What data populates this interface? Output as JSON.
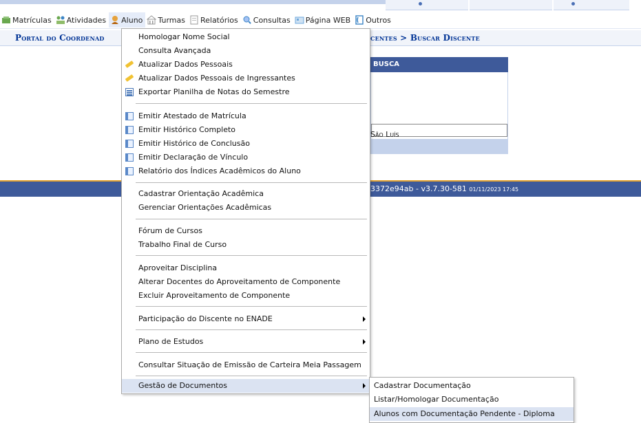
{
  "menubar": {
    "items": [
      {
        "label": "Matrículas",
        "icon": "enrollment-icon"
      },
      {
        "label": "Atividades",
        "icon": "activities-icon"
      },
      {
        "label": "Aluno",
        "icon": "student-icon"
      },
      {
        "label": "Turmas",
        "icon": "classes-icon"
      },
      {
        "label": "Relatórios",
        "icon": "reports-icon"
      },
      {
        "label": "Consultas",
        "icon": "search-icon"
      },
      {
        "label": "Página WEB",
        "icon": "web-page-icon"
      },
      {
        "label": "Outros",
        "icon": "phone-icon"
      }
    ]
  },
  "breadcrumb": {
    "left": "Portal do Coordenad",
    "right": "centes > Buscar Discente"
  },
  "search_panel": {
    "caption": "BUSCA",
    "campus_text": "São Luís"
  },
  "footer": {
    "version": "3372e94ab - v3.7.30-581",
    "datetime": "01/11/2023 17:45"
  },
  "aluno_menu": {
    "items": [
      {
        "label": "Homologar Nome Social",
        "icon": ""
      },
      {
        "label": "Consulta Avançada",
        "icon": ""
      },
      {
        "label": "Atualizar Dados Pessoais",
        "icon": "pencil-icon"
      },
      {
        "label": "Atualizar Dados Pessoais de Ingressantes",
        "icon": "pencil-icon"
      },
      {
        "label": "Exportar Planilha de Notas do Semestre",
        "icon": "document-icon"
      },
      {
        "label": "Emitir Atestado de Matrícula",
        "icon": "sheet-icon"
      },
      {
        "label": "Emitir Histórico Completo",
        "icon": "sheet-icon"
      },
      {
        "label": "Emitir Histórico de Conclusão",
        "icon": "sheet-icon"
      },
      {
        "label": "Emitir Declaração de Vínculo",
        "icon": "sheet-icon"
      },
      {
        "label": "Relatório dos Índices Acadêmicos do Aluno",
        "icon": "sheet-icon"
      },
      {
        "label": "Cadastrar Orientação Acadêmica",
        "icon": ""
      },
      {
        "label": "Gerenciar Orientações Acadêmicas",
        "icon": ""
      },
      {
        "label": "Fórum de Cursos",
        "icon": ""
      },
      {
        "label": "Trabalho Final de Curso",
        "icon": ""
      },
      {
        "label": "Aproveitar Disciplina",
        "icon": ""
      },
      {
        "label": "Alterar Docentes do Aproveitamento de Componente",
        "icon": ""
      },
      {
        "label": "Excluir Aproveitamento de Componente",
        "icon": ""
      },
      {
        "label": "Participação do Discente no ENADE",
        "icon": ""
      },
      {
        "label": "Plano de Estudos",
        "icon": ""
      },
      {
        "label": "Consultar Situação de Emissão de Carteira Meia Passagem",
        "icon": ""
      },
      {
        "label": "Gestão de Documentos",
        "icon": ""
      }
    ]
  },
  "gestao_submenu": {
    "items": [
      {
        "label": "Cadastrar Documentação"
      },
      {
        "label": "Listar/Homologar Documentação"
      },
      {
        "label": "Alunos com Documentação Pendente - Diploma"
      }
    ]
  },
  "colors": {
    "header_blue": "#3e5a9a",
    "breadcrumb_text": "#003395",
    "menu_hover": "#dbe3f2",
    "footer_accent": "#e0a030"
  }
}
